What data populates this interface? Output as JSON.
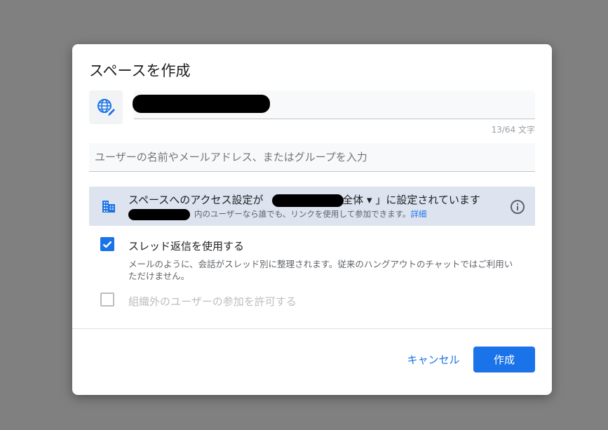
{
  "dialog": {
    "title": "スペースを作成",
    "char_count": "13/64 文字",
    "people_placeholder": "ユーザーの名前やメールアドレス、またはグループを入力",
    "access": {
      "prefix": "スペースへのアクセス設定が",
      "org_suffix": "全体",
      "dropdown_arrow": "▾",
      "suffix": "」に設定されています",
      "description": "内のユーザーなら誰でも、リンクを使用して参加できます。",
      "link": "詳細"
    },
    "options": [
      {
        "label": "スレッド返信を使用する",
        "checked": true,
        "description": "メールのように、会話がスレッド別に整理されます。従来のハングアウトのチャットではご利用いただけません。"
      },
      {
        "label": "組織外のユーザーの参加を許可する",
        "checked": false,
        "disabled": true
      }
    ],
    "buttons": {
      "cancel": "キャンセル",
      "create": "作成"
    }
  },
  "colors": {
    "primary": "#1a73e8",
    "overlay": "#808080",
    "access_bg": "#dde3ef"
  }
}
